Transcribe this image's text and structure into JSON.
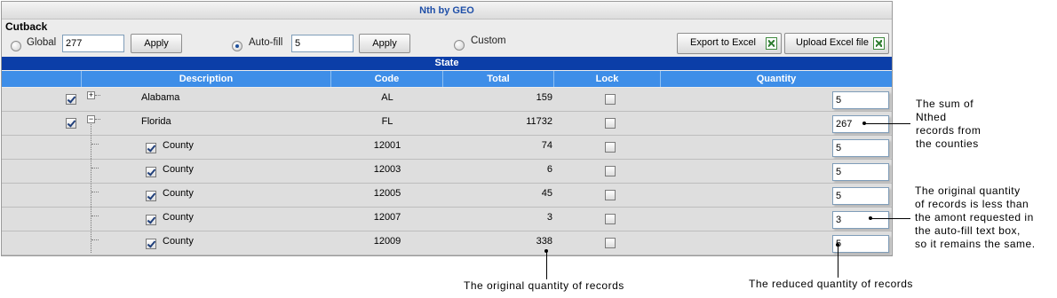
{
  "title": "Nth by GEO",
  "cutback": {
    "label": "Cutback",
    "global_label": "Global",
    "global_value": "277",
    "autofill_label": "Auto-fill",
    "autofill_value": "5",
    "custom_label": "Custom",
    "apply_label": "Apply",
    "selected": "Auto-fill"
  },
  "toolbar": {
    "export_label": "Export to Excel",
    "upload_label": "Upload Excel file",
    "excel_icon": "excel-icon"
  },
  "state_label": "State",
  "columns": [
    "Description",
    "Code",
    "Total",
    "Lock",
    "Quantity"
  ],
  "rows": [
    {
      "description": "Alabama",
      "code": "AL",
      "total": "159",
      "quantity": "5",
      "checked": true,
      "level": 0,
      "expander": "+"
    },
    {
      "description": "Florida",
      "code": "FL",
      "total": "11732",
      "quantity": "267",
      "checked": true,
      "level": 0,
      "expander": "-"
    },
    {
      "description": "County",
      "code": "12001",
      "total": "74",
      "quantity": "5",
      "checked": true,
      "level": 1
    },
    {
      "description": "County",
      "code": "12003",
      "total": "6",
      "quantity": "5",
      "checked": true,
      "level": 1
    },
    {
      "description": "County",
      "code": "12005",
      "total": "45",
      "quantity": "5",
      "checked": true,
      "level": 1
    },
    {
      "description": "County",
      "code": "12007",
      "total": "3",
      "quantity": "3",
      "checked": true,
      "level": 1
    },
    {
      "description": "County",
      "code": "12009",
      "total": "338",
      "quantity": "5",
      "checked": true,
      "level": 1
    }
  ],
  "annotations": {
    "sum": [
      "The sum of",
      "Nthed",
      "records from",
      "the counties"
    ],
    "original_less": [
      "The original quantity",
      "of records is less than",
      "the amont requested in",
      "the auto-fill text box,",
      "so it remains the same."
    ],
    "original_quantity": "The original quantity of records",
    "reduced_quantity": "The reduced quantity of records"
  }
}
